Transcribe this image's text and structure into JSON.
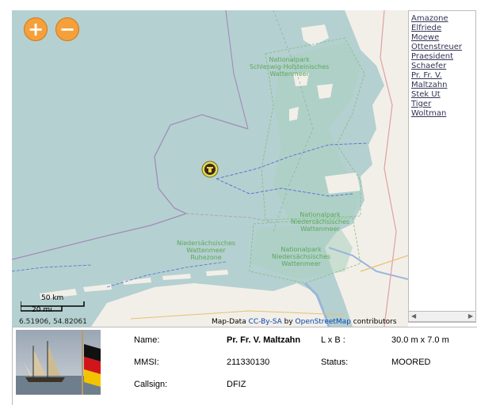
{
  "map": {
    "zoom_in_symbol": "+",
    "zoom_out_symbol": "−",
    "park_labels": [
      {
        "id": "schleswig",
        "lines": [
          "Nationalpark",
          "Schleswig-Holsteinisches",
          "Wattenmeer"
        ]
      },
      {
        "id": "nieders1",
        "lines": [
          "Nationalpark",
          "Niedersächsisches",
          "Wattenmeer"
        ]
      },
      {
        "id": "ruhezone",
        "lines": [
          "Niedersächsisches",
          "Wattenmeer",
          "Ruhezone"
        ]
      },
      {
        "id": "nieders2",
        "lines": [
          "Nationalpark",
          "Niedersächsisches",
          "Wattenmeer"
        ]
      }
    ],
    "scale": {
      "km_label": "50 km",
      "mi_label": "20 mi"
    },
    "coordinates": "6.51906, 54.82061",
    "attribution": {
      "prefix": "Map-Data",
      "license": "CC-By-SA",
      "by": "by",
      "osm": "OpenStreetMap",
      "suffix": "contributors"
    },
    "marker_icon": "ship-marker-icon"
  },
  "ship_list": [
    "Amazone",
    "Elfriede",
    "Moewe",
    "Ottenstreuer",
    "Praesident",
    "Schaefer",
    "Pr. Fr. V. Maltzahn",
    "Stek Ut",
    "Tiger",
    "Woltman"
  ],
  "ship_list_display": [
    "Amazone",
    "Elfriede",
    "Moewe",
    "Ottenstreuer",
    "Praesident",
    "Schaefer",
    "Pr. Fr. V.",
    "Maltzahn",
    "Stek Ut",
    "Tiger",
    "Woltman"
  ],
  "vessel": {
    "name_label": "Name:",
    "name": "Pr. Fr. V. Maltzahn",
    "dims_label": "L x B :",
    "dims": "30.0 m x 7.0 m",
    "mmsi_label": "MMSI:",
    "mmsi": "211330130",
    "status_label": "Status:",
    "status": "MOORED",
    "callsign_label": "Callsign:",
    "callsign": "DFIZ"
  },
  "colors": {
    "sea": "#b5d0d0",
    "land": "#f2efe9",
    "park_green": "#c8e0b8",
    "zoom_button": "#f5a03a"
  }
}
